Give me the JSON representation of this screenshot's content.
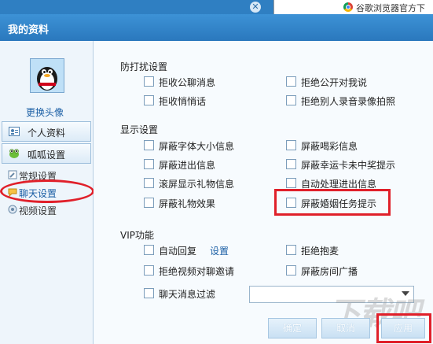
{
  "browser": {
    "tab_text": "谷歌浏览器官方下",
    "close_glyph": "✕"
  },
  "window": {
    "title": "我的资料"
  },
  "sidebar": {
    "change_avatar": "更换头像",
    "items": [
      {
        "label": "个人资料"
      },
      {
        "label": "呱呱设置"
      }
    ],
    "sub_items": [
      {
        "label": "常规设置",
        "icon": "wrench-icon"
      },
      {
        "label": "聊天设置",
        "icon": "chat-icon",
        "active": true
      },
      {
        "label": "视频设置",
        "icon": "camera-icon"
      }
    ]
  },
  "sections": {
    "anti_harass": {
      "title": "防打扰设置",
      "options": [
        "拒收公聊消息",
        "拒绝公开对我说",
        "拒收悄悄话",
        "拒绝别人录音录像拍照"
      ]
    },
    "display": {
      "title": "显示设置",
      "options": [
        "屏蔽字体大小信息",
        "屏蔽喝彩信息",
        "屏蔽进出信息",
        "屏蔽幸运卡未中奖提示",
        "滚屏显示礼物信息",
        "自动处理进出信息",
        "屏蔽礼物效果",
        "屏蔽婚姻任务提示"
      ]
    },
    "vip": {
      "title": "VIP功能",
      "options": [
        "自动回复",
        "拒绝抱麦",
        "拒绝视频对聊邀请",
        "屏蔽房间广播",
        "聊天消息过滤"
      ],
      "setting_link": "设置"
    }
  },
  "buttons": {
    "ok": "确定",
    "cancel": "取消",
    "apply": "应用"
  },
  "watermark": "下载吧",
  "colors": {
    "title_bar": "#2f7fc2",
    "highlight": "#e0202a",
    "link": "#1b5fa5"
  }
}
